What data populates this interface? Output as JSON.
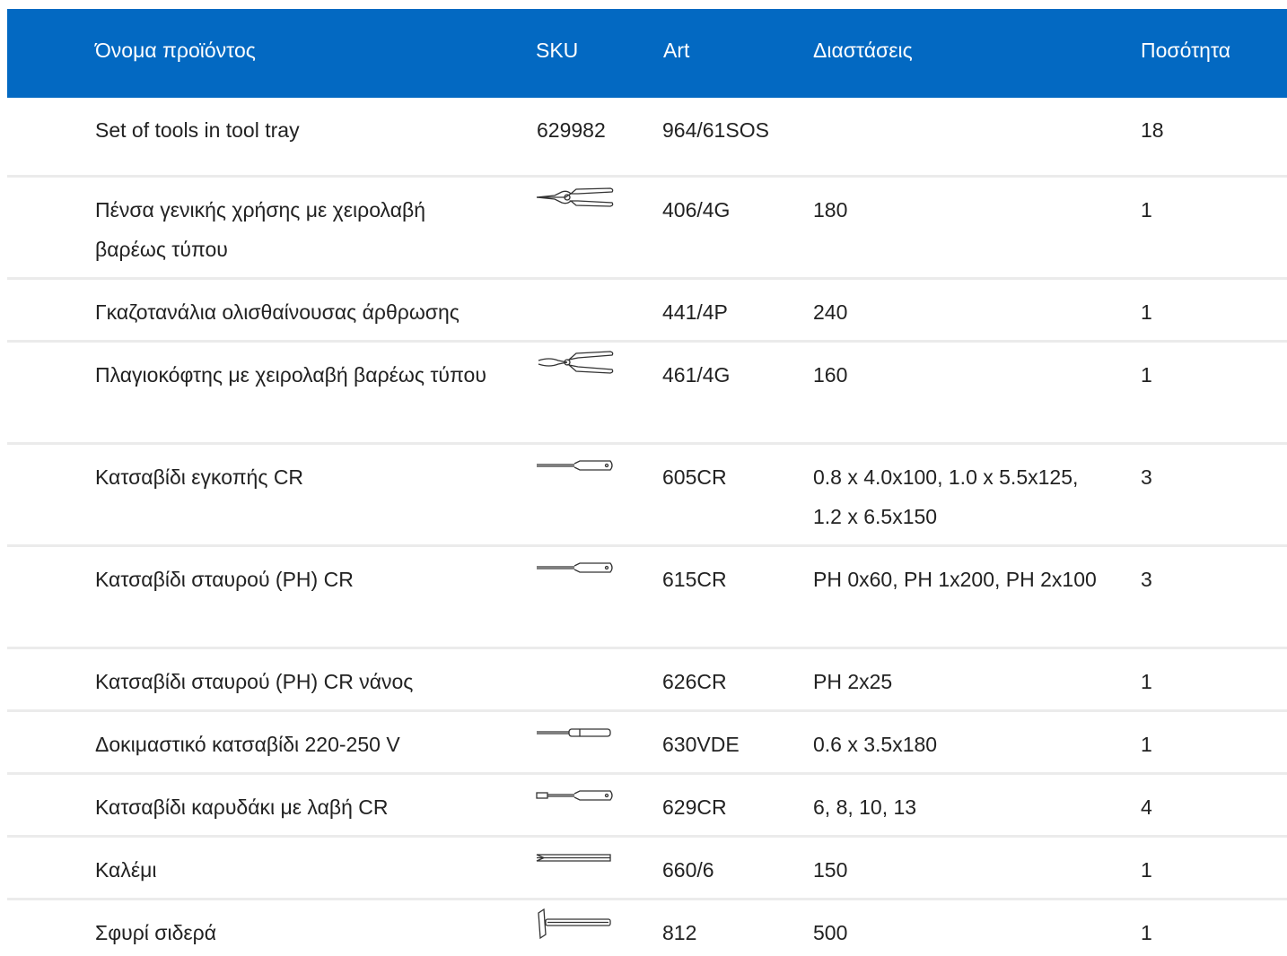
{
  "table": {
    "header": {
      "name": "Όνομα προϊόντος",
      "sku": "SKU",
      "art": "Art",
      "dims": "Διαστάσεις",
      "qty": "Ποσότητα"
    },
    "accent_color": "#0369c2",
    "rows": [
      {
        "name": "Set of tools in tool tray",
        "sku": "629982",
        "image": null,
        "art": "964/61SOS",
        "dims": "",
        "qty": "18"
      },
      {
        "name": "Πένσα γενικής χρήσης με χειρολαβή βαρέως τύπου",
        "sku": "",
        "image": "pliers-icon",
        "art": "406/4G",
        "dims": "180",
        "qty": "1"
      },
      {
        "name": "Γκαζοτανάλια ολισθαίνουσας άρθρωσης",
        "sku": "",
        "image": null,
        "art": "441/4P",
        "dims": "240",
        "qty": "1"
      },
      {
        "name": "Πλαγιοκόφτης με χειρολαβή βαρέως τύπου",
        "sku": "",
        "image": "side-cutter-icon",
        "art": "461/4G",
        "dims": "160",
        "qty": "1"
      },
      {
        "name": "Κατσαβίδι εγκοπής CR",
        "sku": "",
        "image": "screwdriver-icon",
        "art": "605CR",
        "dims": "0.8 x 4.0x100, 1.0 x 5.5x125, 1.2 x 6.5x150",
        "qty": "3"
      },
      {
        "name": "Κατσαβίδι σταυρού (PH) CR",
        "sku": "",
        "image": "screwdriver-icon",
        "art": "615CR",
        "dims": "PH 0x60, PH 1x200, PH 2x100",
        "qty": "3"
      },
      {
        "name": "Κατσαβίδι σταυρού (PH) CR νάνος",
        "sku": "",
        "image": null,
        "art": "626CR",
        "dims": "PH 2x25",
        "qty": "1"
      },
      {
        "name": "Δοκιμαστικό κατσαβίδι 220-250 V",
        "sku": "",
        "image": "voltage-tester-icon",
        "art": "630VDE",
        "dims": "0.6 x 3.5x180",
        "qty": "1"
      },
      {
        "name": "Κατσαβίδι καρυδάκι με λαβή CR",
        "sku": "",
        "image": "nut-driver-icon",
        "art": "629CR",
        "dims": "6, 8, 10, 13",
        "qty": "4"
      },
      {
        "name": "Καλέμι",
        "sku": "",
        "image": "chisel-icon",
        "art": "660/6",
        "dims": "150",
        "qty": "1"
      },
      {
        "name": "Σφυρί σιδερά",
        "sku": "",
        "image": "hammer-icon",
        "art": "812",
        "dims": "500",
        "qty": "1"
      }
    ]
  }
}
